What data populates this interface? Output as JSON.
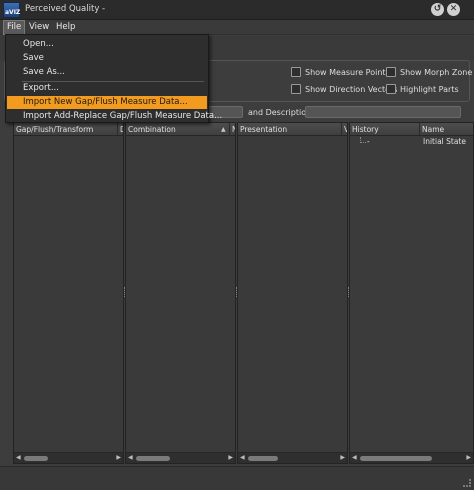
{
  "window": {
    "title": "Perceived Quality -",
    "app_icon_text": "aVIZ",
    "controls": {
      "restore": "↺",
      "close": "✕"
    }
  },
  "menubar": {
    "items": [
      {
        "label": "File",
        "active": true
      },
      {
        "label": "View"
      },
      {
        "label": "Help"
      }
    ]
  },
  "file_menu": {
    "items": [
      {
        "label": "Open..."
      },
      {
        "label": "Save"
      },
      {
        "label": "Save As..."
      },
      {
        "label": "Export..."
      },
      {
        "label": "Import New Gap/Flush Measure Data...",
        "highlighted": true
      },
      {
        "label": "Import Add-Replace Gap/Flush Measure Data..."
      }
    ]
  },
  "options": {
    "show_measure_points": "Show Measure Points",
    "show_morph_zone": "Show Morph Zone",
    "show_direction_vectors": "Show Direction Vectors",
    "highlight_parts": "Highlight Parts"
  },
  "filter": {
    "description_label": "and Description",
    "search_value": "",
    "description_value": ""
  },
  "panels": {
    "gap_flush": {
      "col1": "Gap/Flush/Transform",
      "col2": "D"
    },
    "combination": {
      "col1": "Combination",
      "sort_arrow": "▲",
      "col2": "N"
    },
    "presentation": {
      "col1": "Presentation",
      "col2": "V"
    },
    "history": {
      "col1": "History",
      "col2": "Name",
      "rows": [
        {
          "history": "-",
          "name": "Initial State"
        }
      ]
    }
  },
  "scroll": {
    "left_arrow": "◀",
    "right_arrow": "▶"
  },
  "colors": {
    "highlight": "#f29b1e",
    "background": "#3d3d3d"
  }
}
